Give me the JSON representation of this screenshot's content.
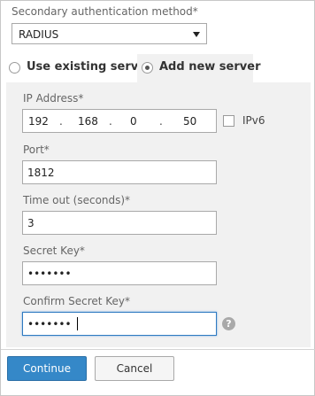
{
  "form": {
    "method_label": "Secondary authentication method*",
    "method_value": "RADIUS"
  },
  "tabs": [
    {
      "label": "Use existing server",
      "selected": false
    },
    {
      "label": "Add new server",
      "selected": true
    }
  ],
  "server": {
    "ip_label": "IP Address*",
    "ip_octets": [
      "192",
      "168",
      "0",
      "50"
    ],
    "ipv6_label": "IPv6",
    "ipv6_checked": false,
    "port_label": "Port*",
    "port_value": "1812",
    "timeout_label": "Time out (seconds)*",
    "timeout_value": "3",
    "secret_label": "Secret Key*",
    "secret_value": "•••••••",
    "confirm_label": "Confirm Secret Key*",
    "confirm_value": "•••••••",
    "help_symbol": "?"
  },
  "buttons": {
    "continue_label": "Continue",
    "cancel_label": "Cancel"
  },
  "colors": {
    "primary": "#3588c8",
    "panel_bg": "#f1f1f1",
    "focus": "#2f7ac1"
  }
}
